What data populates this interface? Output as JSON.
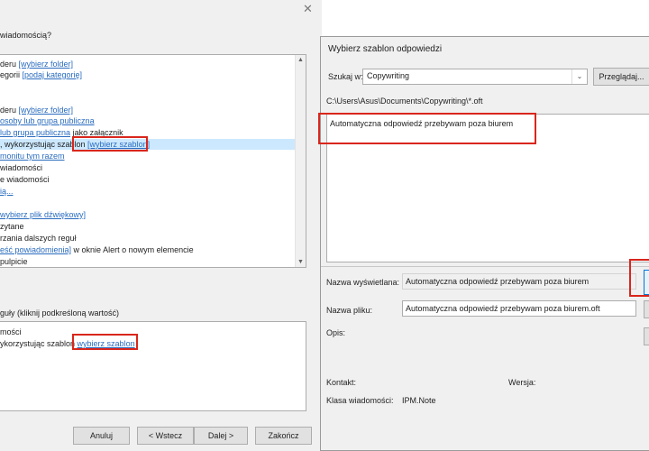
{
  "rules_wizard": {
    "question": "wiadomością?",
    "step1_items": [
      {
        "prefix": "deru ",
        "link": "[wybierz folder]",
        "suffix": ""
      },
      {
        "prefix": "egorii ",
        "link": "[podaj kategorię]",
        "suffix": ""
      },
      {
        "prefix": "deru ",
        "link": "[wybierz folder]",
        "suffix": ""
      },
      {
        "prefix": "",
        "link": "osoby lub grupa publiczna",
        "suffix": ""
      },
      {
        "prefix": "",
        "link": "lub grupa publiczna",
        "suffix": " jako załącznik"
      },
      {
        "prefix": ", wykorzystując szablon ",
        "link": "[wybierz szablon]",
        "suffix": ""
      },
      {
        "prefix": "",
        "link": "monitu tym razem",
        "suffix": ""
      },
      {
        "prefix": "wiadomości",
        "link": "",
        "suffix": ""
      },
      {
        "prefix": "e wiadomości",
        "link": "",
        "suffix": ""
      },
      {
        "prefix": "",
        "link": "ią...",
        "suffix": ""
      },
      {
        "prefix": "",
        "link": "wybierz plik dźwiękowy]",
        "suffix": ""
      },
      {
        "prefix": "zytane",
        "link": "",
        "suffix": ""
      },
      {
        "prefix": "rzania dalszych reguł",
        "link": "",
        "suffix": ""
      },
      {
        "prefix": "",
        "link": "eść powiadomienia]",
        "suffix": " w oknie Alert o nowym elemencie"
      },
      {
        "prefix": "pulpicie",
        "link": "",
        "suffix": ""
      }
    ],
    "step2_label": "guły (kliknij podkreśloną wartość)",
    "step2_items": [
      {
        "prefix": "mości",
        "link": "",
        "suffix": ""
      },
      {
        "prefix": "ykorzystując szablon ",
        "link": "wybierz szablon",
        "suffix": ""
      }
    ],
    "buttons": {
      "cancel": "Anuluj",
      "back": "< Wstecz",
      "next": "Dalej >",
      "finish": "Zakończ"
    }
  },
  "template_dialog": {
    "title": "Wybierz szablon odpowiedzi",
    "look_in_label": "Szukaj w:",
    "look_in_value": "Copywriting",
    "browse_button": "Przeglądaj...",
    "path": "C:\\Users\\Asus\\Documents\\Copywriting\\*.oft",
    "files": [
      "Automatyczna odpowiedź przebywam poza biurem"
    ],
    "display_name_label": "Nazwa wyświetlana:",
    "display_name_value": "Automatyczna odpowiedź przebywam poza biurem",
    "file_name_label": "Nazwa pliku:",
    "file_name_value": "Automatyczna odpowiedź przebywam poza biurem.oft",
    "description_label": "Opis:",
    "contact_label": "Kontakt:",
    "version_label": "Wersja:",
    "message_class_label": "Klasa wiadomości:",
    "message_class_value": "IPM.Note"
  },
  "colors": {
    "highlight_box": "#d9261c",
    "link": "#2a6cbf",
    "selection": "#cce8ff"
  }
}
